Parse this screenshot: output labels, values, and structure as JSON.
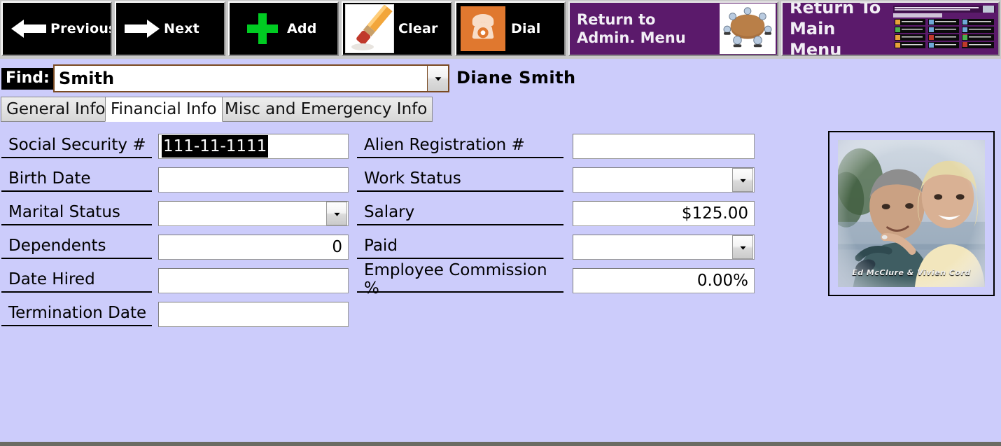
{
  "toolbar": {
    "buttons": [
      {
        "id": "previous",
        "label": "Previous",
        "icon": "arrow-left-icon"
      },
      {
        "id": "next",
        "label": "Next",
        "icon": "arrow-right-icon"
      },
      {
        "id": "add",
        "label": "Add",
        "icon": "green-plus-icon"
      },
      {
        "id": "clear",
        "label": "Clear",
        "icon": "pencil-eraser-icon"
      },
      {
        "id": "dial",
        "label": "Dial",
        "icon": "telephone-icon"
      }
    ],
    "admin_menu_label": "Return to\nAdmin. Menu",
    "admin_menu_icon": "meeting-table-icon",
    "main_menu_label": "Return To\nMain Menu",
    "main_menu_icon": "main-menu-thumbnail",
    "main_menu_thumb": {
      "title": "The Antique Mall FastTrack Point of Sale & Business Management 7.0 Software",
      "date_line": "Today's Date: Tuesday, October 08, 2013",
      "items": [
        "Store Sales/Layaway/Rental or Vendor",
        "Financial Reports",
        "Administrative Menu",
        "Mall/Mill Vendors, Dealers, Consignors",
        "All Sales/Daily Report",
        "Shop and Play Database",
        "Store Inventory",
        "More Financial Reports",
        "Technical Support",
        "Search Inventory",
        "Vendor Contracts and Agreements",
        "Mall/Mill Phone Address Directory",
        "Bookkeeping",
        "Print, Catalog of Thumbnail Inventory",
        "Sell or Close Database"
      ]
    },
    "colors": {
      "purple": "#5b1a6b",
      "orange": "#e0782f",
      "green": "#00c000"
    }
  },
  "find": {
    "label": "Find:",
    "value": "Smith",
    "placeholder": "",
    "dropdown_icon": "chevron-down-icon",
    "record_name": "Diane  Smith"
  },
  "tabs": [
    {
      "label": "General Info",
      "active": false
    },
    {
      "label": "Financial Info",
      "active": true
    },
    {
      "label": "Misc and Emergency Info",
      "active": false
    }
  ],
  "form": {
    "left": [
      {
        "label": "Social Security #",
        "value": "111-11-1111",
        "type": "text",
        "selected": true
      },
      {
        "label": "Birth Date",
        "value": "",
        "type": "text"
      },
      {
        "label": "Marital Status",
        "value": "",
        "type": "combo"
      },
      {
        "label": "Dependents",
        "value": "0",
        "type": "number"
      },
      {
        "label": "Date Hired",
        "value": "",
        "type": "text"
      },
      {
        "label": "Termination Date",
        "value": "",
        "type": "text"
      }
    ],
    "right": [
      {
        "label": "Alien Registration #",
        "value": "",
        "type": "text"
      },
      {
        "label": "Work Status",
        "value": "",
        "type": "combo"
      },
      {
        "label": "Salary",
        "value": "$125.00",
        "type": "number"
      },
      {
        "label": "Paid",
        "value": "",
        "type": "combo"
      },
      {
        "label": "Employee Commission %",
        "value": "0.00%",
        "type": "number"
      }
    ]
  },
  "photo": {
    "caption": "Ed McClure & Vivien Cord",
    "name": "employee-photo"
  },
  "colors": {
    "background": "#ccccfb",
    "toolbar_background": "#c9c9c9",
    "field_background": "#ffffff"
  }
}
